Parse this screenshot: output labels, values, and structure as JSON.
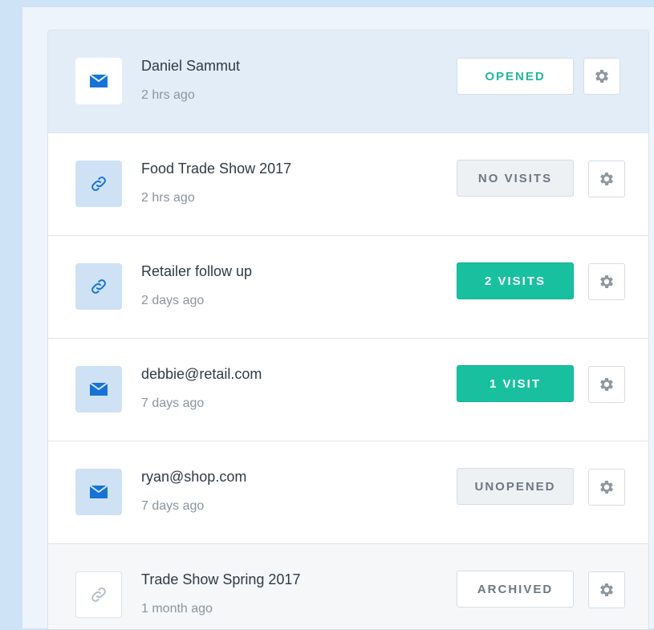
{
  "items": [
    {
      "title": "Daniel Sammut",
      "time": "2 hrs ago",
      "status": "OPENED",
      "icon": "mail-icon",
      "status_style": "outline-green"
    },
    {
      "title": "Food Trade Show 2017",
      "time": "2 hrs ago",
      "status": "NO VISITS",
      "icon": "link-icon",
      "status_style": "gray"
    },
    {
      "title": "Retailer follow up",
      "time": "2 days ago",
      "status": "2 VISITS",
      "icon": "link-icon",
      "status_style": "green"
    },
    {
      "title": "debbie@retail.com",
      "time": "7 days ago",
      "status": "1 VISIT",
      "icon": "mail-icon",
      "status_style": "green"
    },
    {
      "title": "ryan@shop.com",
      "time": "7 days ago",
      "status": "UNOPENED",
      "icon": "mail-icon",
      "status_style": "gray"
    },
    {
      "title": "Trade Show Spring 2017",
      "time": "1 month ago",
      "status": "ARCHIVED",
      "icon": "link-icon",
      "status_style": "gray"
    }
  ],
  "colors": {
    "background": "#cfe3f7",
    "selected_row": "#e3edf8",
    "accent_green": "#18c0a0",
    "icon_blue": "#1673d6"
  }
}
